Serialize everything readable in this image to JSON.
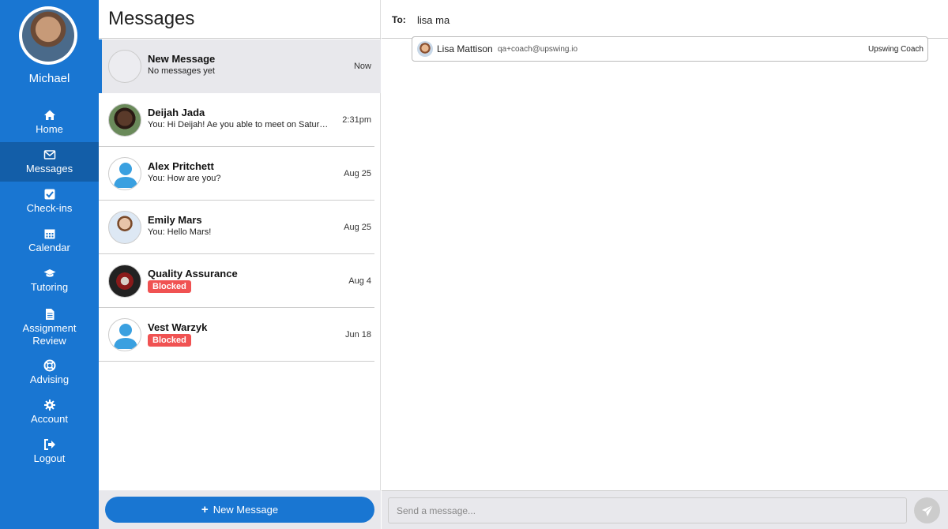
{
  "sidebar": {
    "user_name": "Michael",
    "items": [
      {
        "label": "Home",
        "icon": "home-icon"
      },
      {
        "label": "Messages",
        "icon": "envelope-icon",
        "active": true
      },
      {
        "label": "Check-ins",
        "icon": "check-square-icon"
      },
      {
        "label": "Calendar",
        "icon": "calendar-icon"
      },
      {
        "label": "Tutoring",
        "icon": "graduation-cap-icon"
      },
      {
        "label_line1": "Assignment",
        "label_line2": "Review",
        "icon": "document-icon"
      },
      {
        "label": "Advising",
        "icon": "life-ring-icon"
      },
      {
        "label": "Account",
        "icon": "gear-icon"
      },
      {
        "label": "Logout",
        "icon": "sign-out-icon"
      }
    ]
  },
  "list": {
    "title": "Messages",
    "conversations": [
      {
        "name": "New Message",
        "preview": "No messages yet",
        "time": "Now"
      },
      {
        "name": "Deijah Jada",
        "preview": "You: Hi Deijah! Ae you able to meet on Saturday...",
        "time": "2:31pm"
      },
      {
        "name": "Alex Pritchett",
        "preview": "You: How are you?",
        "time": "Aug 25"
      },
      {
        "name": "Emily Mars",
        "preview": "You: Hello Mars!",
        "time": "Aug 25"
      },
      {
        "name": "Quality Assurance",
        "badge": "Blocked",
        "time": "Aug 4"
      },
      {
        "name": "Vest Warzyk",
        "badge": "Blocked",
        "time": "Jun 18"
      }
    ],
    "new_message_label": "New Message"
  },
  "compose": {
    "to_label": "To:",
    "to_value": "lisa ma",
    "suggestion": {
      "name": "Lisa Mattison",
      "email": "qa+coach@upswing.io",
      "role": "Upswing Coach"
    },
    "message_placeholder": "Send a message..."
  },
  "colors": {
    "primary": "#1976d2",
    "primary_active": "#135ea8",
    "blocked": "#f05252",
    "panel_gray": "#e8e8ec",
    "avatar_blue": "#3aa0e0"
  }
}
